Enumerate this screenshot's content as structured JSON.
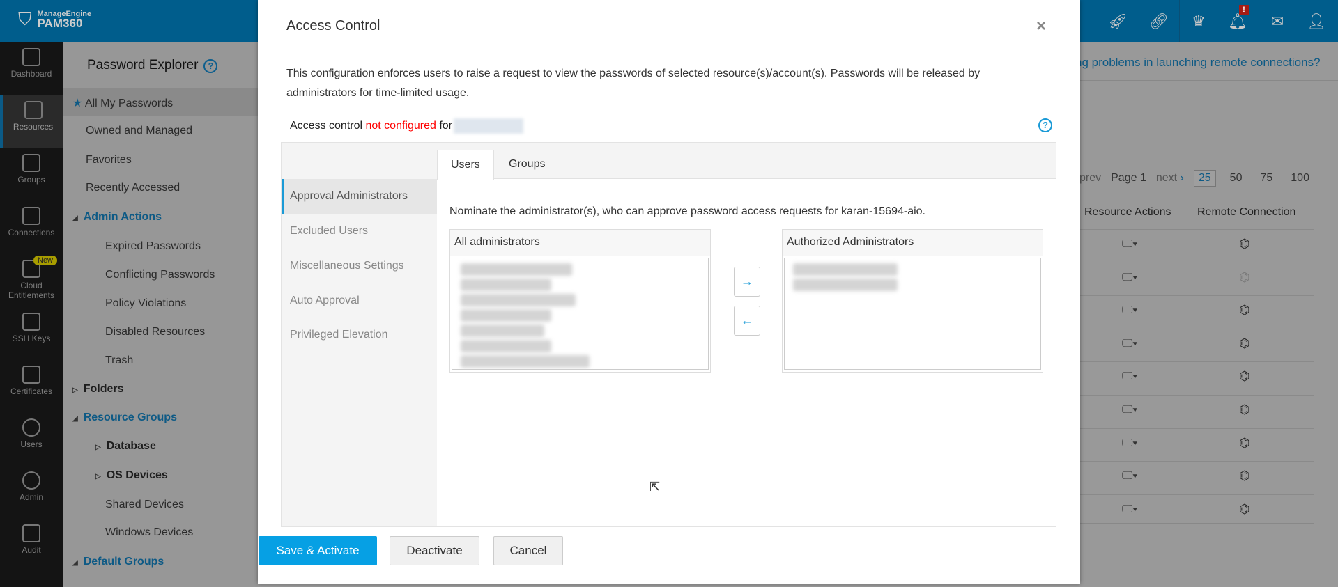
{
  "topbar": {
    "brand_top": "ManageEngine",
    "brand": "PAM360",
    "icons": [
      "rocket-icon",
      "link-icon",
      "crown-icon",
      "bell-icon",
      "mail-icon",
      "user-icon"
    ],
    "alert_badge": "!"
  },
  "leftnav": [
    {
      "label": "Dashboard"
    },
    {
      "label": "Resources"
    },
    {
      "label": "Groups"
    },
    {
      "label": "Connections"
    },
    {
      "label": "Cloud Entitlements"
    },
    {
      "label": "SSH Keys"
    },
    {
      "label": "Certificates"
    },
    {
      "label": "Users"
    },
    {
      "label": "Admin"
    },
    {
      "label": "Audit"
    }
  ],
  "new_badge": "New",
  "sidebar": {
    "title": "Password Explorer",
    "items": [
      "All My Passwords",
      "Owned and Managed",
      "Favorites",
      "Recently Accessed",
      "Admin Actions",
      "Expired Passwords",
      "Conflicting Passwords",
      "Policy Violations",
      "Disabled Resources",
      "Trash",
      "Folders",
      "Resource Groups",
      "Database",
      "OS Devices",
      "Shared Devices",
      "Windows Devices",
      "Default Groups"
    ]
  },
  "main": {
    "tip_link": "ng problems in launching remote connections?",
    "pager": {
      "prev": "prev",
      "page": "Page 1",
      "next": "next",
      "sizes": [
        "25",
        "50",
        "75",
        "100"
      ],
      "selected": "25"
    },
    "columns": [
      "Resource Actions",
      "Remote Connection"
    ],
    "row_count": 9
  },
  "modal": {
    "title": "Access Control",
    "close": "×",
    "description": "This configuration enforces users to raise a request to view the passwords of selected resource(s)/account(s). Passwords will be released by administrators for time-limited usage.",
    "status_prefix": "Access control ",
    "status_state": "not configured",
    "status_suffix": " for",
    "nav": [
      "Approval Administrators",
      "Excluded Users",
      "Miscellaneous Settings",
      "Auto Approval",
      "Privileged Elevation"
    ],
    "tabs": [
      "Users",
      "Groups"
    ],
    "nominate": "Nominate the administrator(s), who can approve password access requests for karan-15694-aio.",
    "all_header": "All administrators",
    "auth_header": "Authorized Administrators",
    "move_right": "→",
    "move_left": "←",
    "buttons": {
      "save": "Save & Activate",
      "deactivate": "Deactivate",
      "cancel": "Cancel"
    }
  },
  "colors": {
    "accent": "#06a0e4",
    "danger": "#ff0000",
    "topbar": "#005d8c"
  }
}
